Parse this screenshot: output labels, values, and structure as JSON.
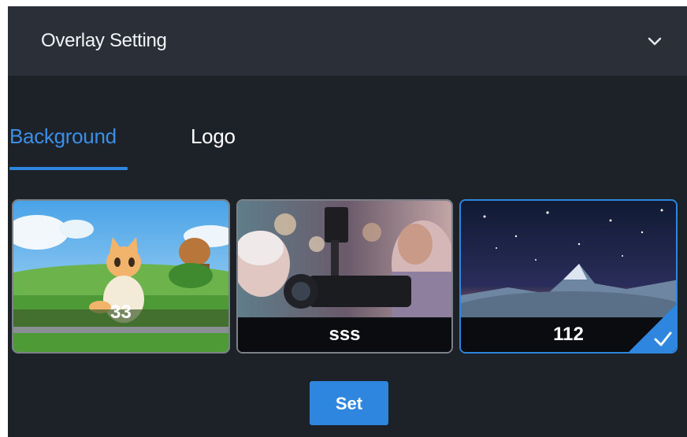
{
  "header": {
    "title": "Overlay Setting",
    "toggle_icon": "chevron-down-icon"
  },
  "tabs": [
    {
      "label": "Background",
      "active": true
    },
    {
      "label": "Logo",
      "active": false
    }
  ],
  "backgrounds": [
    {
      "name": "33",
      "image": "cartoon-cat-in-meadow",
      "selected": false
    },
    {
      "name": "sss",
      "image": "woman-with-camera-rig",
      "selected": false
    },
    {
      "name": "112",
      "image": "starry-night-mountain",
      "selected": true,
      "selected_icon": "checkmark-icon"
    }
  ],
  "actions": {
    "set_label": "Set"
  },
  "colors": {
    "accent": "#2e86de",
    "panel_bg": "#1d2128",
    "header_bg": "#2a2f38"
  }
}
